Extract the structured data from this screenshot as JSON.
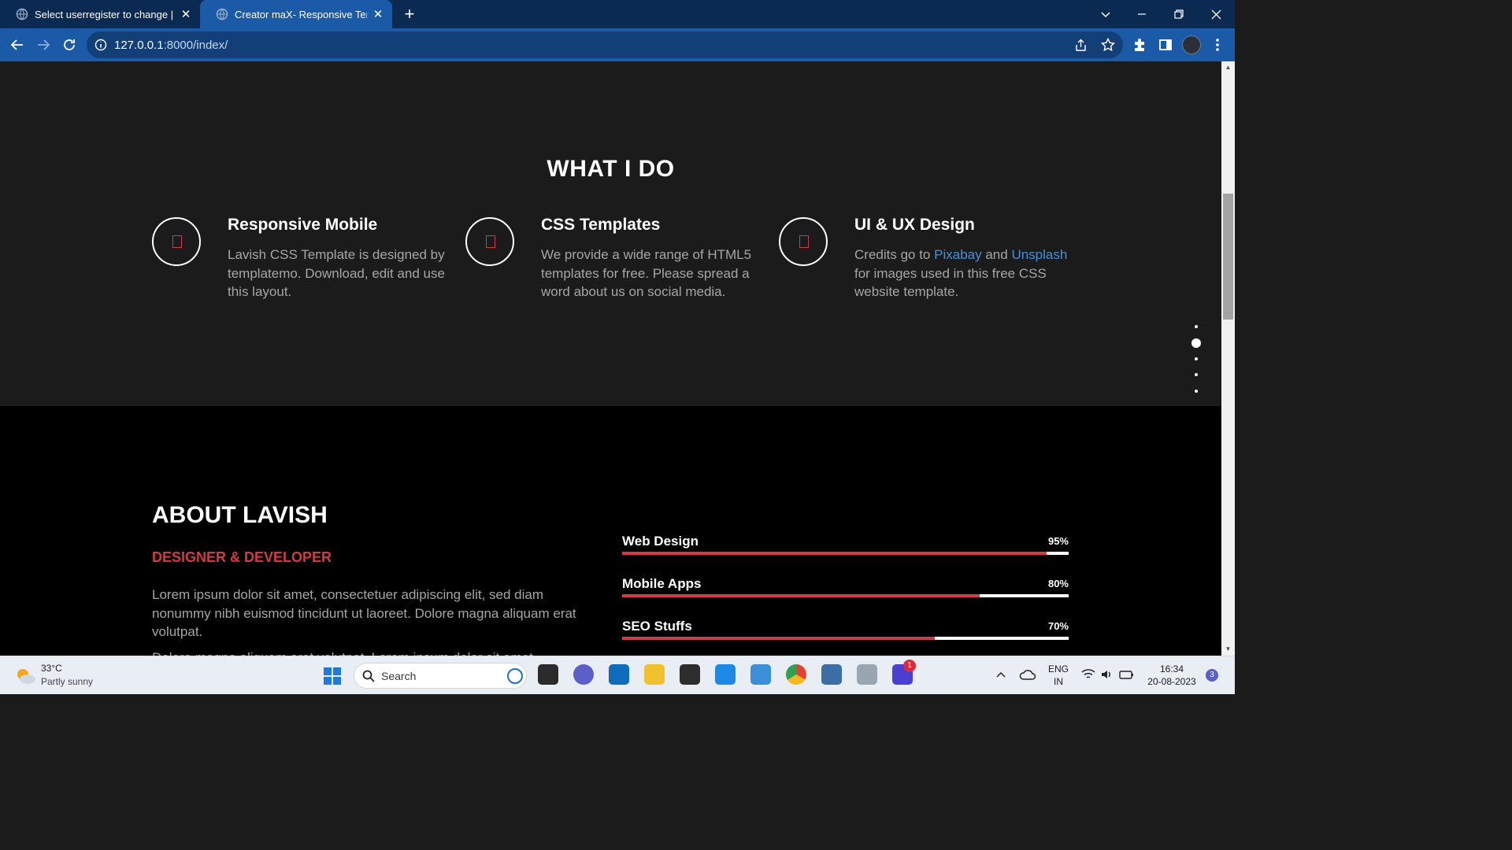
{
  "browser": {
    "tabs": [
      {
        "title": "Select userregister to change | Dj",
        "active": false
      },
      {
        "title": "Creator maX- Responsive Templa",
        "active": true
      }
    ],
    "url_host": "127.0.0.1",
    "url_path": ":8000/index/"
  },
  "services": {
    "heading": "WHAT I DO",
    "items": [
      {
        "title": "Responsive Mobile",
        "text": "Lavish CSS Template is designed by templatemo. Download, edit and use this layout."
      },
      {
        "title": "CSS Templates",
        "text": "We provide a wide range of HTML5 templates for free. Please spread a word about us on social media."
      },
      {
        "title": "UI & UX Design",
        "text_before": "Credits go to",
        "link1": "Pixabay",
        "text_mid": "and",
        "link2": "Unsplash",
        "text_after": "for images used in this free CSS website template."
      }
    ]
  },
  "about": {
    "heading": "ABOUT LAVISH",
    "subheading": "DESIGNER & DEVELOPER",
    "paragraph1": "Lorem ipsum dolor sit amet, consectetuer adipiscing elit, sed diam nonummy nibh euismod tincidunt ut laoreet. Dolore magna aliquam erat volutpat.",
    "paragraph2": "Dolore magna aliquam erat volutpat. Lorem ipsum dolor sit amet,",
    "skills": [
      {
        "name": "Web Design",
        "percent_label": "95%",
        "value": 95
      },
      {
        "name": "Mobile Apps",
        "percent_label": "80%",
        "value": 80
      },
      {
        "name": "SEO Stuffs",
        "percent_label": "70%",
        "value": 70
      }
    ]
  },
  "page_nav": {
    "dot_count": 5,
    "active_index": 1
  },
  "taskbar": {
    "weather_temp": "33°C",
    "weather_desc": "Partly sunny",
    "search_label": "Search",
    "lang_line1": "ENG",
    "lang_line2": "IN",
    "time": "16:34",
    "date": "20-08-2023",
    "notification_count": "3",
    "app_badge": "1"
  },
  "colors": {
    "accent": "#d23a48",
    "link": "#4a8fd8",
    "chrome_bg": "#0b2a52",
    "toolbar_bg": "#1a5aa6"
  }
}
